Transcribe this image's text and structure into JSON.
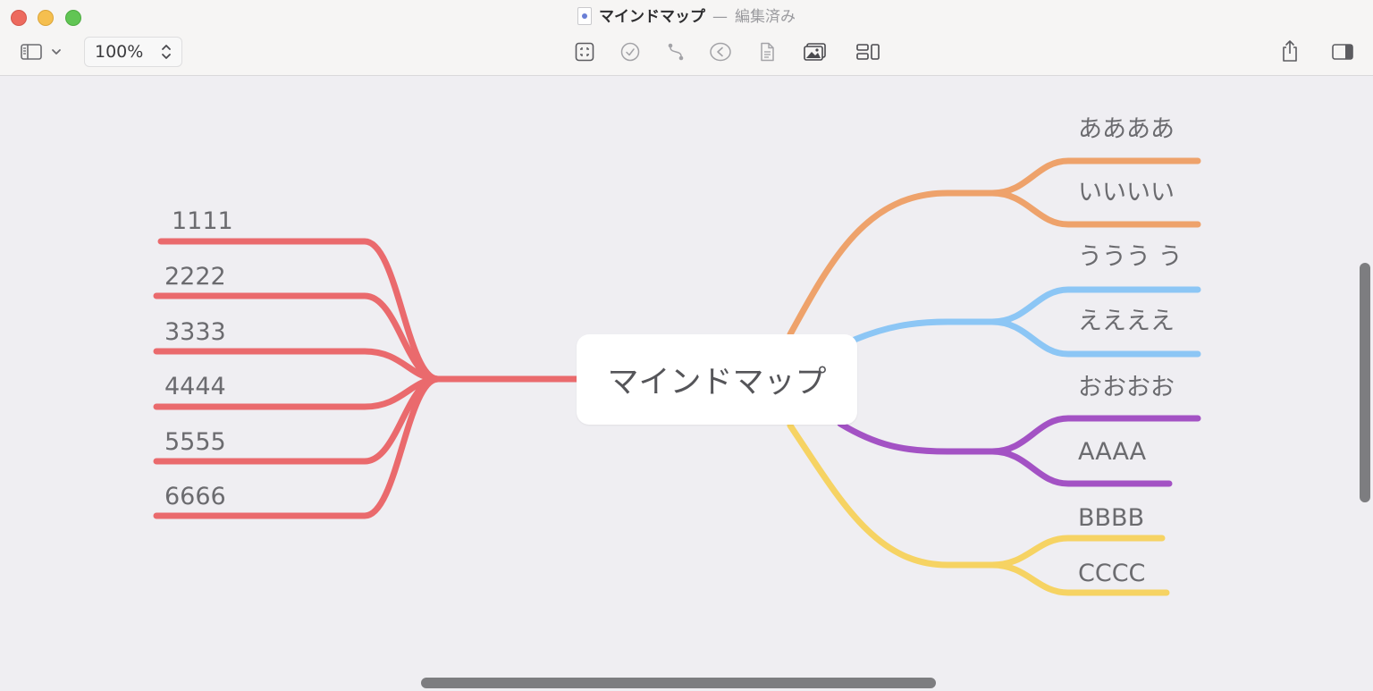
{
  "window": {
    "title": "マインドマップ",
    "separator": "—",
    "status": "編集済み"
  },
  "toolbar": {
    "zoom_value": "100%",
    "icons": {
      "sidebar": "sidebar-icon",
      "focus": "focus-icon",
      "task": "checkmark-circle-icon",
      "relationship": "relationship-icon",
      "collapse": "chevron-left-circle-icon",
      "note": "note-icon",
      "image": "image-icon",
      "layout": "layout-icon",
      "share": "share-icon",
      "inspector": "inspector-icon"
    }
  },
  "mindmap": {
    "central": "マインドマップ",
    "left_branch": {
      "color": "#ea6a6d",
      "children": [
        "1111",
        "2222",
        "3333",
        "4444",
        "5555",
        "6666"
      ]
    },
    "right_branches": [
      {
        "color": "#eea26b",
        "children": [
          "ああああ",
          "いいいい"
        ]
      },
      {
        "color": "#8cc6f5",
        "children": [
          "ううう う",
          "ええええ"
        ]
      },
      {
        "color": "#a352c4",
        "children": [
          "おおおお",
          "AAAA"
        ]
      },
      {
        "color": "#f6d363",
        "children": [
          "BBBB",
          "CCCC"
        ]
      }
    ]
  }
}
